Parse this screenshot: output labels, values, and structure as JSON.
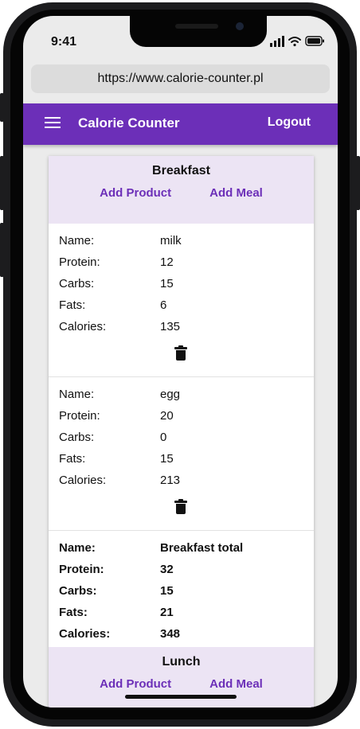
{
  "status_bar": {
    "time": "9:41"
  },
  "browser": {
    "url": "https://www.calorie-counter.pl"
  },
  "app_bar": {
    "title": "Calorie Counter",
    "logout_label": "Logout"
  },
  "labels": {
    "name": "Name:",
    "protein": "Protein:",
    "carbs": "Carbs:",
    "fats": "Fats:",
    "calories": "Calories:"
  },
  "breakfast": {
    "title": "Breakfast",
    "add_product_label": "Add Product",
    "add_meal_label": "Add Meal",
    "products": [
      {
        "name": "milk",
        "protein": "12",
        "carbs": "15",
        "fats": "6",
        "calories": "135"
      },
      {
        "name": "egg",
        "protein": "20",
        "carbs": "0",
        "fats": "15",
        "calories": "213"
      }
    ],
    "total": {
      "name": "Breakfast total",
      "protein": "32",
      "carbs": "15",
      "fats": "21",
      "calories": "348"
    }
  },
  "lunch": {
    "title": "Lunch",
    "add_product_label": "Add Product",
    "add_meal_label": "Add Meal"
  },
  "icons": {
    "menu": "hamburger-icon",
    "delete": "trash-icon",
    "signal": "cellular-signal-icon",
    "wifi": "wifi-icon",
    "battery": "battery-icon"
  },
  "colors": {
    "primary": "#6c2fb8",
    "header_tint": "#ece4f4"
  }
}
